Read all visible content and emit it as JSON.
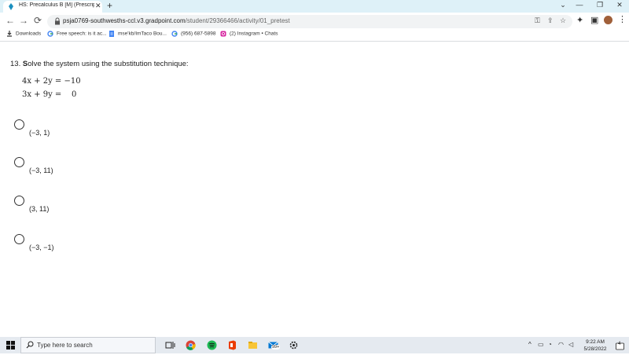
{
  "browser": {
    "tab_title": "HS: Precalculus B [M] (Prescriptiv",
    "tab_close": "✕",
    "new_tab": "+",
    "window_controls": [
      "⌄",
      "—",
      "❐",
      "✕"
    ],
    "back": "←",
    "forward": "→",
    "reload": "⟳",
    "url_domain": "psja0769-southwesths-ccl.v3.gradpoint.com",
    "url_path": "/student/29366466/activity/01_pretest",
    "icons": [
      "key-icon",
      "share-icon",
      "star-icon",
      "extensions-icon",
      "reading-list-icon",
      "profile-avatar",
      "menu-icon"
    ]
  },
  "bookmarks": [
    {
      "label": "Downloads",
      "icon": "download-icon"
    },
    {
      "label": "Free speech: is it ac...",
      "icon": "google-icon"
    },
    {
      "label": "mse'kb/ImTaco Bou...",
      "icon": "docs-icon"
    },
    {
      "label": "(956) 687-5898",
      "icon": "google-icon"
    },
    {
      "label": "(2) Instagram • Chats",
      "icon": "instagram-icon"
    }
  ],
  "question": {
    "number": "13. ",
    "first_letter": "S",
    "text": "olve the system using the substitution technique:",
    "equation_1": "4x + 2y = −10",
    "equation_2": "3x + 9y =    0"
  },
  "options": [
    "(−3, 1)",
    "(−3, 11)",
    "(3, 11)",
    "(−3, −1)"
  ],
  "taskbar": {
    "search_placeholder": "Type here to search",
    "apps": [
      "task-view-icon",
      "chrome-icon",
      "spotify-icon",
      "office-icon",
      "file-explorer-icon",
      "mail-icon",
      "settings-icon"
    ],
    "mail_badge": "99+",
    "time": "9:22 AM",
    "date": "5/28/2022",
    "notification_count": "4"
  },
  "colors": {
    "tab_strip": "#def1f8",
    "taskbar": "#e5eaf0"
  }
}
